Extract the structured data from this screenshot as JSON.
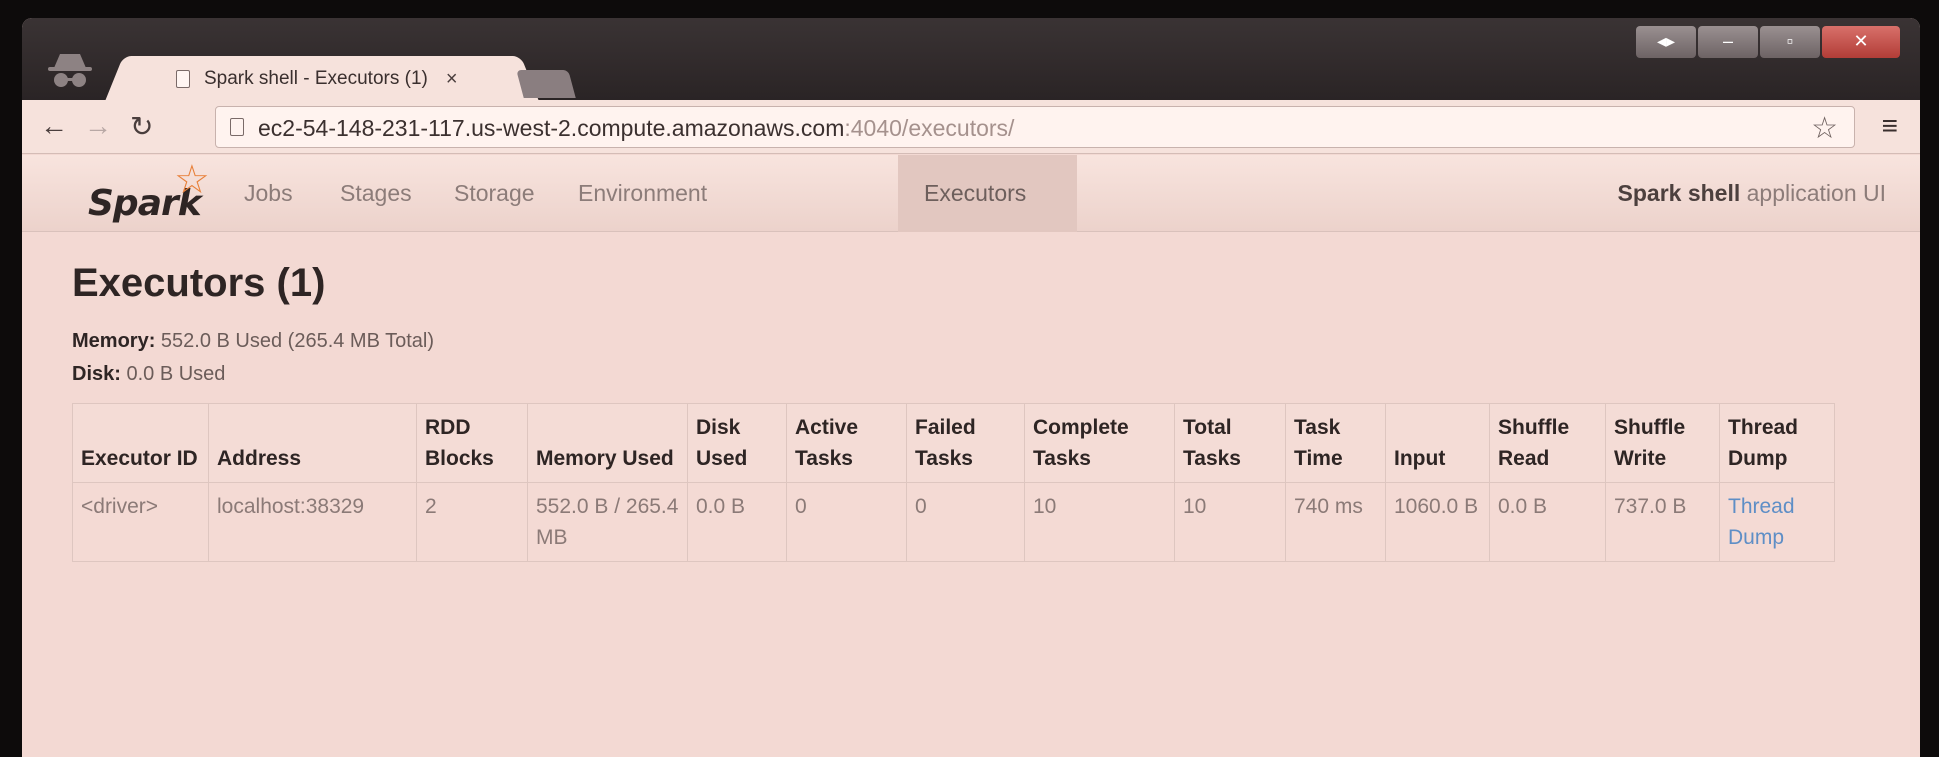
{
  "browser": {
    "tab_title": "Spark shell - Executors (1)",
    "tab_close": "×",
    "url_host": "ec2-54-148-231-117.us-west-2.compute.amazonaws.com",
    "url_rest": ":4040/executors/"
  },
  "spark_nav": {
    "logo": "Spark",
    "items": [
      "Jobs",
      "Stages",
      "Storage",
      "Environment",
      "Executors"
    ],
    "active_item": "Executors",
    "app_name_bold": "Spark shell",
    "app_name_rest": " application UI"
  },
  "page": {
    "title": "Executors (1)",
    "memory_label": "Memory:",
    "memory_value": " 552.0 B Used (265.4 MB Total)",
    "disk_label": "Disk:",
    "disk_value": " 0.0 B Used"
  },
  "table": {
    "headers": [
      "Executor ID",
      "Address",
      "RDD Blocks",
      "Memory Used",
      "Disk Used",
      "Active Tasks",
      "Failed Tasks",
      "Complete Tasks",
      "Total Tasks",
      "Task Time",
      "Input",
      "Shuffle Read",
      "Shuffle Write",
      "Thread Dump"
    ],
    "rows": [
      [
        "<driver>",
        "localhost:38329",
        "2",
        "552.0 B / 265.4 MB",
        "0.0 B",
        "0",
        "0",
        "10",
        "10",
        "740 ms",
        "1060.0 B",
        "0.0 B",
        "737.0 B",
        "Thread Dump"
      ]
    ]
  },
  "icons": {
    "back": "back-arrow-icon",
    "forward": "forward-arrow-icon",
    "reload": "reload-icon",
    "bookmark": "star-icon",
    "menu": "hamburger-menu-icon",
    "incognito": "incognito-icon",
    "page": "document-icon"
  }
}
